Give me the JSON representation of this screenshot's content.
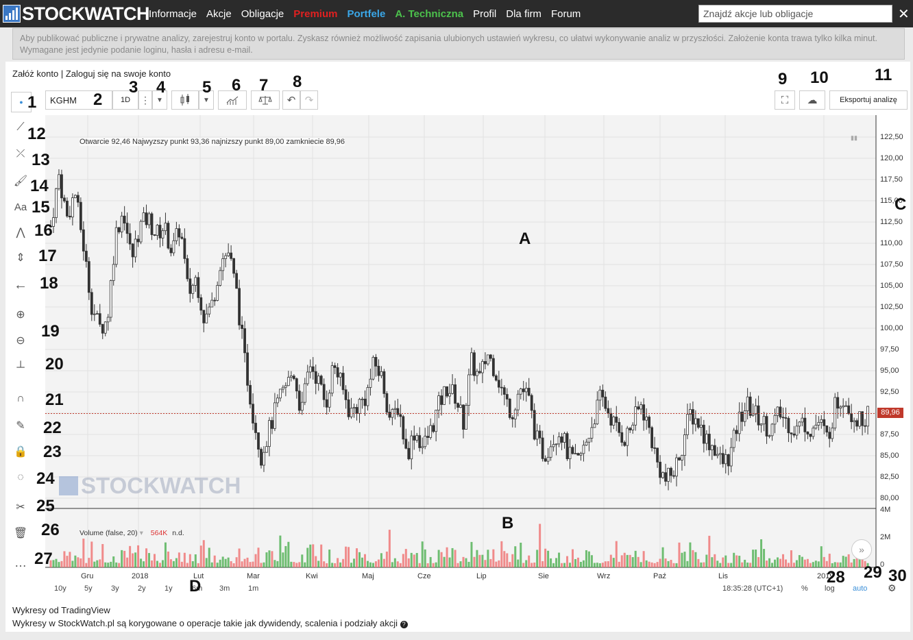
{
  "header": {
    "brand": "STOCKWATCH",
    "nav": [
      "Informacje",
      "Akcje",
      "Obligacje",
      "Premium",
      "Portfele",
      "A. Techniczna",
      "Profil",
      "Dla firm",
      "Forum"
    ],
    "nav_colors": [
      "#ffffff",
      "#ffffff",
      "#ffffff",
      "#e02020",
      "#3aa7e8",
      "#4cc24c",
      "#ffffff",
      "#ffffff",
      "#ffffff"
    ],
    "search_placeholder": "Znajdź akcje lub obligacje",
    "close": "✕"
  },
  "notice": "Aby publikować publiczne i prywatne analizy, zarejestruj konto w portalu. Zyskasz również możliwość zapisania ulubionych ustawień wykresu, co ułatwi wykonywanie analiz w przyszłości. Założenie konta trawa tylko kilka minut. Wymagane jest jedynie podanie loginu, hasła i adresu e-mail.",
  "account": {
    "register": "Załóż konto",
    "sep": "|",
    "login": "Zaloguj się na swoje konto"
  },
  "toolbar": {
    "symbol": "KGHM",
    "interval": "1D",
    "export": "Eksportuj analizę"
  },
  "legend": {
    "ohlc": "Otwarcie 92,46 Najwyzszy punkt 93,36 najnizszy punkt 89,00 zamkniecie 89,96",
    "volume": "Volume (false, 20)",
    "volume_value": "564K",
    "volume_na": "n.d."
  },
  "watermark": "STOCKWATCH",
  "labels": {
    "a": "A",
    "b": "B",
    "c": "C",
    "d": "D"
  },
  "numbers": [
    "1",
    "2",
    "3",
    "4",
    "5",
    "6",
    "7",
    "8",
    "9",
    "10",
    "11",
    "12",
    "13",
    "14",
    "15",
    "16",
    "17",
    "18",
    "19",
    "20",
    "21",
    "22",
    "23",
    "24",
    "25",
    "26",
    "27",
    "28",
    "29",
    "30"
  ],
  "chart_data": {
    "type": "candlestick",
    "symbol": "KGHM",
    "y_ticks": [
      "122,50",
      "120,00",
      "117,50",
      "115,00",
      "112,50",
      "110,00",
      "107,50",
      "105,00",
      "102,50",
      "100,00",
      "97,50",
      "95,00",
      "92,50",
      "90,00",
      "87,50",
      "85,00",
      "82,50",
      "80,00"
    ],
    "ylim": [
      79,
      124
    ],
    "last_price": "89,96",
    "last_price_color": "#c0392b",
    "x_ticks": [
      "Gru",
      "2018",
      "Lut",
      "Mar",
      "Kwi",
      "Maj",
      "Cze",
      "Lip",
      "Sie",
      "Wrz",
      "Paź",
      "Lis",
      "2019"
    ],
    "volume_ticks": [
      "4M",
      "2M",
      "0"
    ],
    "up_color": "#4caf50",
    "down_color": "#ef6f6f",
    "close_path": [
      112,
      118,
      113,
      116,
      110,
      103,
      100,
      101,
      111,
      114,
      108,
      112,
      113,
      111,
      112,
      109,
      112,
      104,
      106,
      101,
      103,
      108,
      109,
      104,
      96,
      90,
      85,
      88,
      91,
      93,
      95,
      90,
      96,
      94,
      91,
      96,
      93,
      90,
      91,
      92,
      96,
      94,
      89,
      91,
      85,
      88,
      86,
      88,
      91,
      93,
      92,
      89,
      96,
      94,
      97,
      95,
      92,
      90,
      93,
      92,
      87,
      85,
      87,
      88,
      85,
      84,
      86,
      89,
      92,
      90,
      88,
      87,
      89,
      91,
      88,
      84,
      82,
      83,
      86,
      90,
      89,
      87,
      86,
      84,
      85,
      89,
      91,
      90,
      89,
      88,
      90,
      89,
      88,
      89,
      88,
      89,
      87,
      91,
      92,
      90,
      89,
      90
    ]
  },
  "range_buttons": [
    "10y",
    "5y",
    "3y",
    "2y",
    "1y",
    "6m",
    "3m",
    "1m"
  ],
  "status": {
    "time": "18:35:28 (UTC+1)",
    "pct": "%",
    "log": "log",
    "auto": "auto"
  },
  "footer": {
    "l1": "Wykresy od TradingView",
    "l2": "Wykresy w StockWatch.pl są korygowane o operacje takie jak dywidendy, scalenia i podziały akcji"
  }
}
